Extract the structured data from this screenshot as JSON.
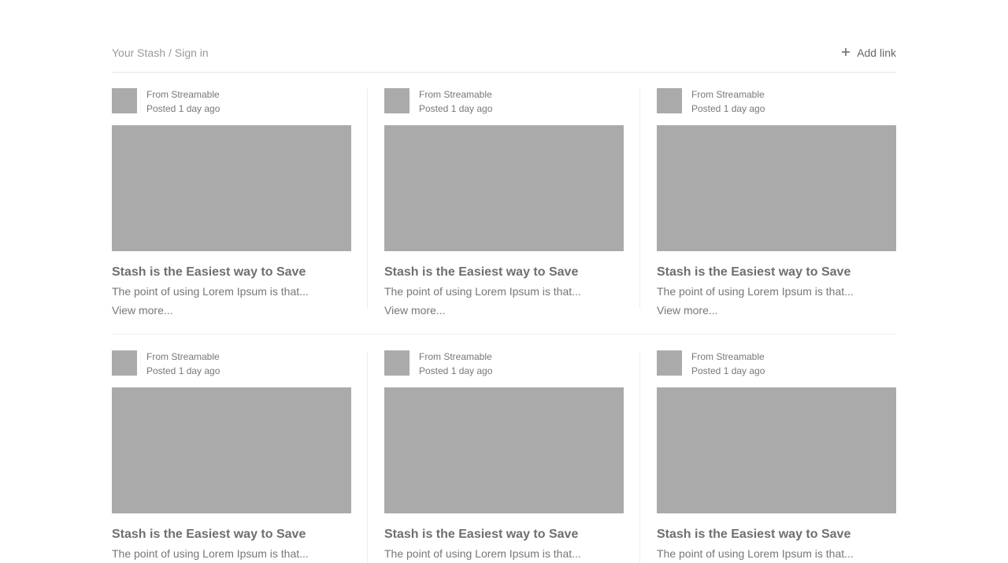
{
  "header": {
    "breadcrumb_stash": "Your Stash",
    "breadcrumb_sep": "/",
    "breadcrumb_signin": "Sign in",
    "add_link_label": "Add link",
    "add_icon": "plus-icon"
  },
  "cards": [
    {
      "source": "From Streamable",
      "posted": "Posted 1 day ago",
      "title": "Stash is the Easiest way to Save",
      "description": "The point of using Lorem Ipsum is that...",
      "more": "View more..."
    },
    {
      "source": "From Streamable",
      "posted": "Posted 1 day ago",
      "title": "Stash is the Easiest way to Save",
      "description": "The point of using Lorem Ipsum is that...",
      "more": "View more..."
    },
    {
      "source": "From Streamable",
      "posted": "Posted 1 day ago",
      "title": "Stash is the Easiest way to Save",
      "description": "The point of using Lorem Ipsum is that...",
      "more": "View more..."
    },
    {
      "source": "From Streamable",
      "posted": "Posted 1 day ago",
      "title": "Stash is the Easiest way to Save",
      "description": "The point of using Lorem Ipsum is that..."
    },
    {
      "source": "From Streamable",
      "posted": "Posted 1 day ago",
      "title": "Stash is the Easiest way to Save",
      "description": "The point of using Lorem Ipsum is that..."
    },
    {
      "source": "From Streamable",
      "posted": "Posted 1 day ago",
      "title": "Stash is the Easiest way to Save",
      "description": "The point of using Lorem Ipsum is that..."
    }
  ],
  "colors": {
    "placeholder": "#aaaaaa",
    "text_muted": "#9a9a9a",
    "text": "#777777"
  }
}
